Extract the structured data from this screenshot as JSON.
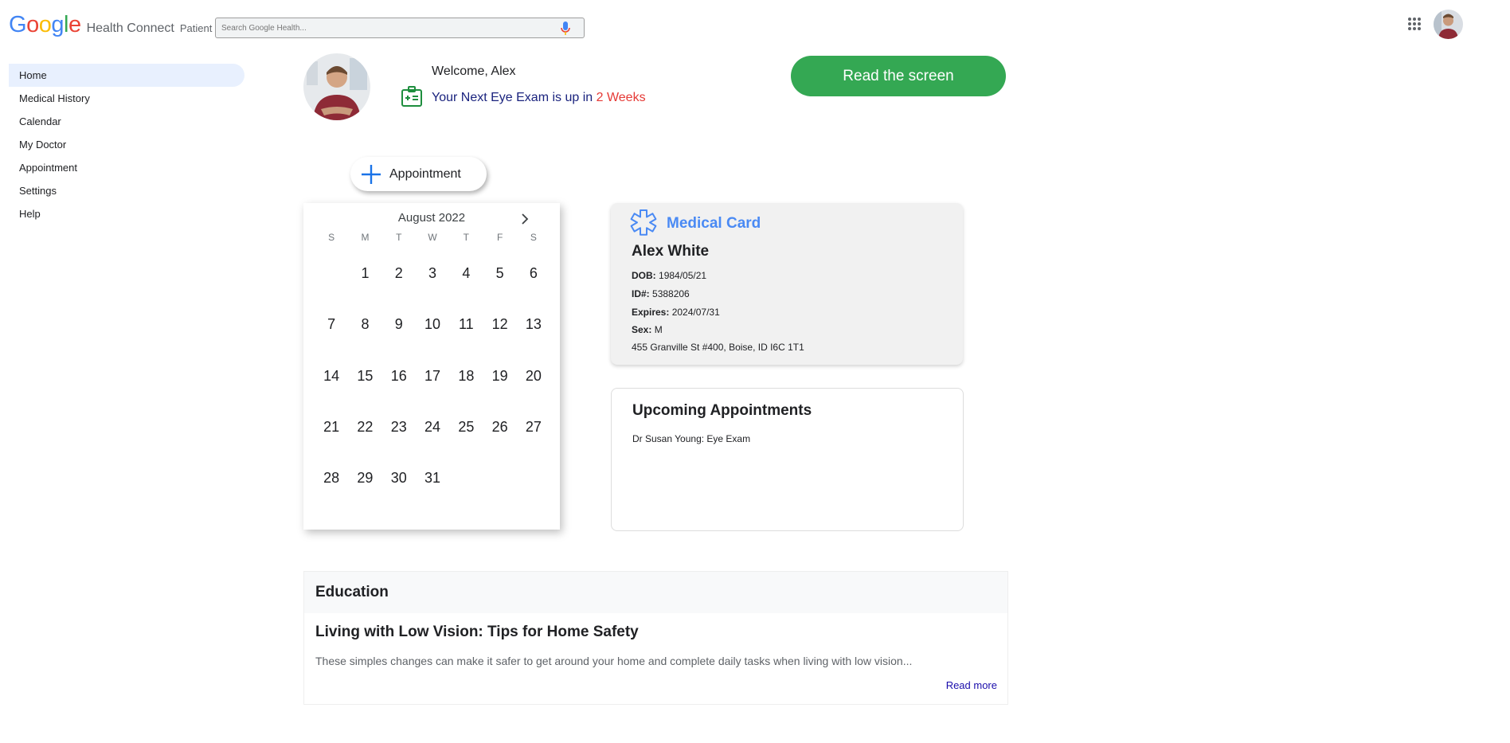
{
  "header": {
    "logo_letters": [
      "G",
      "o",
      "o",
      "g",
      "l",
      "e"
    ],
    "app_name": "Health Connect",
    "role": "Patient",
    "search_placeholder": "Search Google Health..."
  },
  "sidebar": {
    "items": [
      {
        "label": "Home",
        "active": true
      },
      {
        "label": "Medical History"
      },
      {
        "label": "Calendar"
      },
      {
        "label": "My Doctor"
      },
      {
        "label": "Appointment"
      },
      {
        "label": "Settings"
      },
      {
        "label": "Help"
      }
    ]
  },
  "welcome": {
    "greeting": "Welcome, Alex",
    "exam_text": "Your Next Eye Exam is up in ",
    "exam_weeks": "2 Weeks"
  },
  "read_button": "Read the screen",
  "appointment_button": "Appointment",
  "calendar": {
    "month": "August 2022",
    "weekdays": [
      "S",
      "M",
      "T",
      "W",
      "T",
      "F",
      "S"
    ],
    "days": [
      "",
      "1",
      "2",
      "3",
      "4",
      "5",
      "6",
      "7",
      "8",
      "9",
      "10",
      "11",
      "12",
      "13",
      "14",
      "15",
      "16",
      "17",
      "18",
      "19",
      "20",
      "21",
      "22",
      "23",
      "24",
      "25",
      "26",
      "27",
      "28",
      "29",
      "30",
      "31"
    ]
  },
  "medical_card": {
    "title": "Medical Card",
    "name": "Alex White",
    "dob_label": "DOB:",
    "dob": "1984/05/21",
    "id_label": "ID#:",
    "id": "5388206",
    "expires_label": "Expires:",
    "expires": "2024/07/31",
    "sex_label": "Sex:",
    "sex": "M",
    "address": "455 Granville St #400, Boise, ID I6C 1T1"
  },
  "upcoming": {
    "title": "Upcoming Appointments",
    "items": [
      "Dr Susan Young: Eye Exam"
    ]
  },
  "education": {
    "heading": "Education",
    "article_title": "Living with Low Vision: Tips for Home Safety",
    "article_desc": "These simples changes can make it safer to get around your home and complete daily tasks when living with low vision...",
    "read_more": "Read more"
  },
  "colors": {
    "google_blue": "#4285f4",
    "google_red": "#ea4335",
    "google_yellow": "#fbbc05",
    "google_green": "#34a853",
    "read_button": "#34a853",
    "medical_card_title": "#4a8af4",
    "exam_weeks": "#e53935",
    "nav_active": "#e8f0fe"
  },
  "icons": [
    "mic-icon",
    "apps-icon",
    "eye-exam-icon",
    "plus-icon",
    "chevron-right-icon",
    "medical-cross-icon"
  ]
}
